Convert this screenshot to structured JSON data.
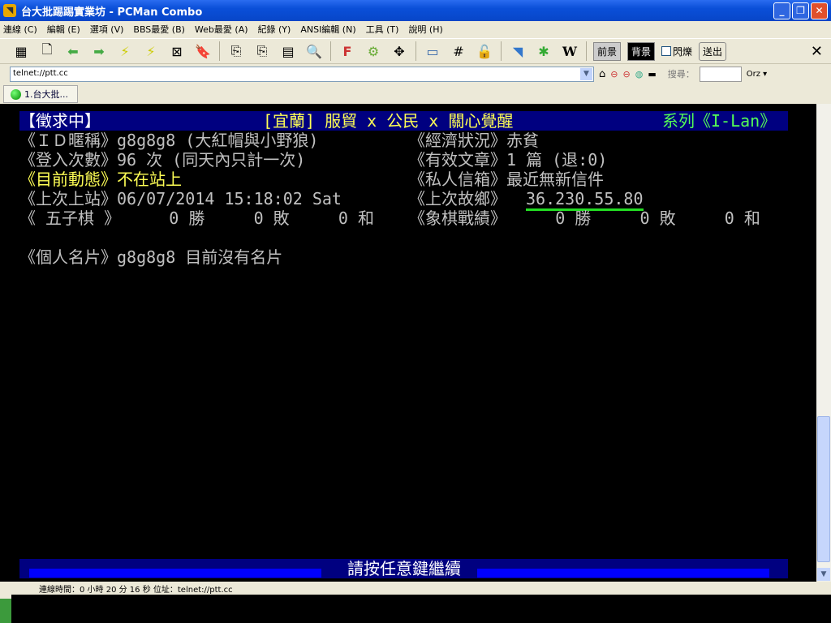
{
  "window": {
    "title": "台大批踢踢實業坊 - PCMan Combo"
  },
  "menu": [
    "連線 (C)",
    "編輯 (E)",
    "選項 (V)",
    "BBS最愛 (B)",
    "Web最愛 (A)",
    "紀錄 (Y)",
    "ANSI編輯 (N)",
    "工具 (T)",
    "說明 (H)"
  ],
  "toolbar": {
    "fg_label": "前景",
    "bg_label": "背景",
    "blink_label": "閃爍",
    "send_label": "送出"
  },
  "address": {
    "value": "telnet://ptt.cc",
    "search_label": "搜尋：",
    "search_engine": "Orz"
  },
  "tab": {
    "label": "1.台大批..."
  },
  "terminal": {
    "header": {
      "left": "【徵求中】",
      "middle": "[宜蘭] 服貿 x 公民 x 關心覺醒",
      "right": "系列《I-Lan》"
    },
    "rows": [
      {
        "left": "《ＩＤ暱稱》g8g8g8 (大紅帽與小野狼)",
        "right": "《經濟狀況》赤貧"
      },
      {
        "left": "《登入次數》96 次 (同天內只計一次)",
        "right": "《有效文章》1 篇 (退:0)"
      },
      {
        "left": "《目前動態》不在站上",
        "right": "《私人信箱》最近無新信件"
      },
      {
        "left": "《上次上站》06/07/2014 15:18:02 Sat",
        "right_label": "《上次故鄉》",
        "right_value": "36.230.55.80"
      },
      {
        "left": "《 五子棋 》     0 勝     0 敗     0 和",
        "right": "《象棋戰績》     0 勝     0 敗     0 和"
      }
    ],
    "card": "《個人名片》g8g8g8 目前沒有名片",
    "footer": "請按任意鍵繼續"
  },
  "status": {
    "text": "連線時間：0 小時 20 分 16 秒     位址：telnet://ptt.cc"
  }
}
